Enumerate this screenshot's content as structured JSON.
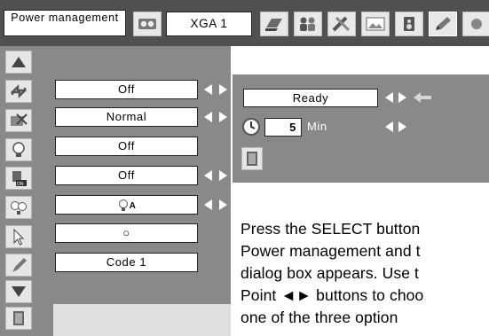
{
  "menubar": {
    "title": "Power management",
    "input_value": "XGA 1",
    "icons": [
      "projector-speaker-icon",
      "laptop-icon",
      "people-icon",
      "tools-icon",
      "image-icon",
      "speaker-icon",
      "pencil-icon",
      "menu-icon"
    ]
  },
  "sidebar": {
    "icons": [
      "up-arrow-icon",
      "input-icon",
      "image-adjust-icon",
      "lamp-icon",
      "power-icon",
      "lamp-cluster-icon",
      "pointer-icon",
      "pencil-icon",
      "down-arrow-icon",
      "exit-icon"
    ]
  },
  "settings": {
    "rows": [
      {
        "value": "Off",
        "arrows": true
      },
      {
        "value": "Normal",
        "arrows": true
      },
      {
        "value": "Off",
        "arrows": false
      },
      {
        "value": "Off",
        "arrows": true
      },
      {
        "value": "A",
        "arrows": true,
        "type": "lamp"
      },
      {
        "value": "○",
        "arrows": false
      },
      {
        "value": "Code 1",
        "arrows": false
      }
    ]
  },
  "dialog": {
    "mode_value": "Ready",
    "timer_value": "5",
    "timer_unit": "Min"
  },
  "instructions": {
    "lines": [
      "Press the SELECT button",
      "Power management and t",
      "dialog box appears. Use t",
      "Point ◄► buttons to choo",
      "one of the three option"
    ]
  },
  "colors": {
    "dark_panel": "#898989",
    "menubar": "#505050",
    "light_strip": "#e0e0e0"
  }
}
